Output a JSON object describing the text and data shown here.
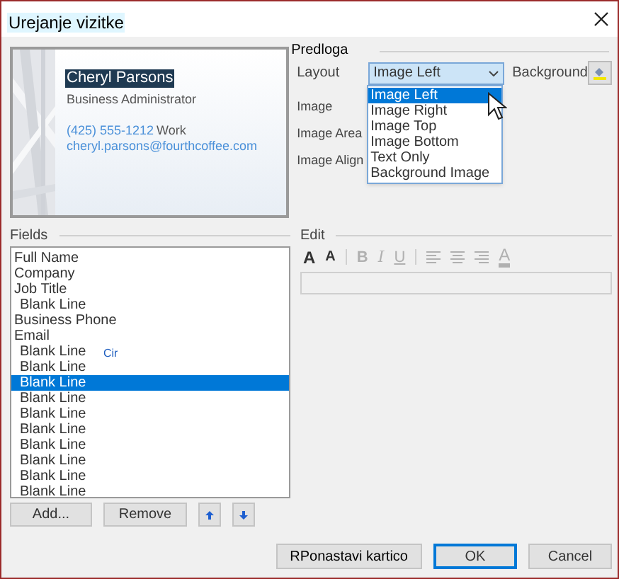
{
  "window": {
    "title_overlay": "Urejanje vizitke"
  },
  "card_preview": {
    "name_overlay": "Cheryl Parsons",
    "job_title": "Business Administrator",
    "phone": "(425) 555-1212",
    "phone_label": "Work",
    "email": "cheryl.parsons@fourthcoffee.com"
  },
  "card_design": {
    "title_overlay": "Predloga",
    "layout_label": "Layout",
    "layout_value": "Image Left",
    "background_label": "Background",
    "image_label": "Image",
    "image_area_label": "Image Area",
    "image_align_label": "Image Align",
    "dropdown": [
      {
        "label": "Image Left",
        "selected": true
      },
      {
        "label": "Image Right",
        "selected": false
      },
      {
        "label": "Image Top",
        "selected": false
      },
      {
        "label": "Image Bottom",
        "selected": false
      },
      {
        "label": "Text Only",
        "selected": false
      },
      {
        "label": "Background Image",
        "selected": false
      }
    ]
  },
  "fields": {
    "title": "Fields",
    "items": [
      {
        "label": "Full Name",
        "selected": false
      },
      {
        "label": "Company",
        "selected": false
      },
      {
        "label": "Job Title",
        "selected": false,
        "children": [
          {
            "label": "Blank Line",
            "selected": false
          }
        ]
      },
      {
        "label": "Business Phone",
        "selected": false
      },
      {
        "label": "Email",
        "selected": false,
        "children": [
          {
            "label": "Blank Line",
            "selected": false
          },
          {
            "label": "Blank Line",
            "selected": false
          },
          {
            "label": "Blank Line",
            "selected": true
          },
          {
            "label": "Blank Line",
            "selected": false
          },
          {
            "label": "Blank Line",
            "selected": false
          },
          {
            "label": "Blank Line",
            "selected": false
          },
          {
            "label": "Blank Line",
            "selected": false
          },
          {
            "label": "Blank Line",
            "selected": false
          },
          {
            "label": "Blank Line",
            "selected": false
          },
          {
            "label": "Blank Line",
            "selected": false
          }
        ]
      }
    ],
    "cursor_overlay": "Cir",
    "add_button": "Add...",
    "remove_button": "Remove"
  },
  "edit": {
    "title": "Edit",
    "toolbar": [
      {
        "kind": "grow",
        "label": "A",
        "disabled": false
      },
      {
        "kind": "shrink",
        "label": "A",
        "disabled": false
      },
      {
        "kind": "bold",
        "label": "B",
        "disabled": true
      },
      {
        "kind": "italic",
        "label": "I",
        "disabled": true
      },
      {
        "kind": "underline",
        "label": "U",
        "disabled": true
      },
      {
        "kind": "align_left",
        "disabled": true
      },
      {
        "kind": "align_center",
        "disabled": true
      },
      {
        "kind": "align_right",
        "disabled": true
      },
      {
        "kind": "font_color",
        "label": "A",
        "disabled": true
      }
    ]
  },
  "footer": {
    "reset_label": "R",
    "reset_overlay": "Ponastavi kartico",
    "ok": {
      "label": "OK",
      "selected": true
    },
    "cancel": {
      "label": "Cancel",
      "selected": false
    }
  }
}
